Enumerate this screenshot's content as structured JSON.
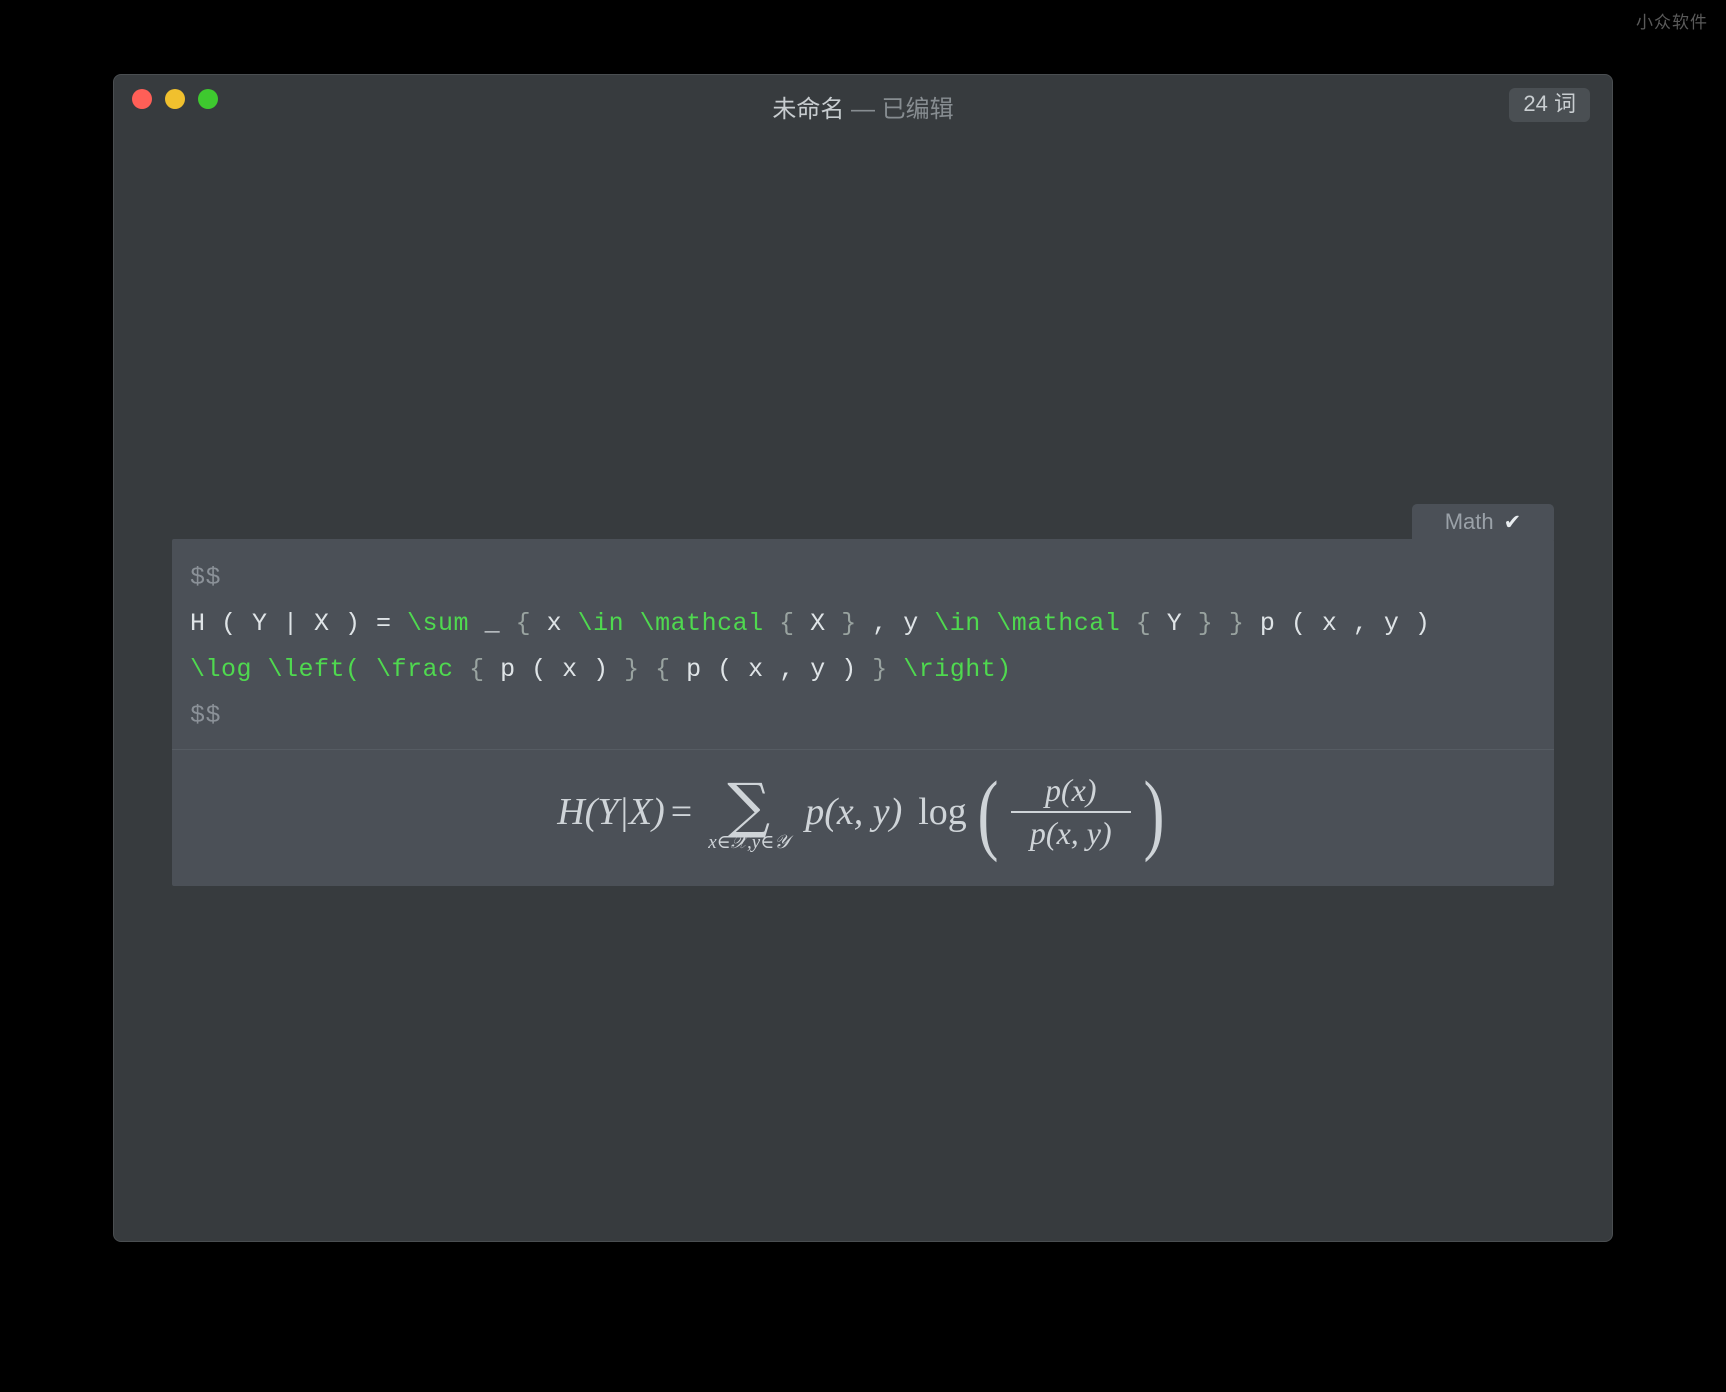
{
  "watermark": "小众软件",
  "window": {
    "titlebar": {
      "title_name": "未命名",
      "title_separator": " — ",
      "title_state": "已编辑",
      "word_count": "24 词",
      "traffic_lights": [
        {
          "name": "close",
          "color": "#ff5f57"
        },
        {
          "name": "minimize",
          "color": "#f0c02e"
        },
        {
          "name": "maximize",
          "color": "#3ec92f"
        }
      ]
    },
    "math_block": {
      "tab_label": "Math",
      "tab_check": "✔",
      "code_lines": [
        {
          "id": "open-delim",
          "tokens": [
            {
              "t": "$$",
              "k": "delim"
            }
          ]
        },
        {
          "id": "latex-line-1",
          "tokens": [
            {
              "t": "H ( Y | X ) = ",
              "k": "plain"
            },
            {
              "t": "\\sum",
              "k": "cmd"
            },
            {
              "t": " _ ",
              "k": "plain"
            },
            {
              "t": "{",
              "k": "brace"
            },
            {
              "t": " x ",
              "k": "plain"
            },
            {
              "t": "\\in \\mathcal",
              "k": "cmd"
            },
            {
              "t": " ",
              "k": "plain"
            },
            {
              "t": "{",
              "k": "brace"
            },
            {
              "t": " X ",
              "k": "plain"
            },
            {
              "t": "}",
              "k": "brace"
            },
            {
              "t": " , y ",
              "k": "plain"
            },
            {
              "t": "\\in \\mathcal",
              "k": "cmd"
            },
            {
              "t": " ",
              "k": "plain"
            },
            {
              "t": "{",
              "k": "brace"
            },
            {
              "t": " Y ",
              "k": "plain"
            },
            {
              "t": "}",
              "k": "brace"
            },
            {
              "t": " ",
              "k": "plain"
            },
            {
              "t": "}",
              "k": "brace"
            },
            {
              "t": " p ( x , y )",
              "k": "plain"
            }
          ]
        },
        {
          "id": "latex-line-2",
          "tokens": [
            {
              "t": "\\log \\left(",
              "k": "cmd"
            },
            {
              "t": " ",
              "k": "plain"
            },
            {
              "t": "\\frac",
              "k": "cmd"
            },
            {
              "t": " ",
              "k": "plain"
            },
            {
              "t": "{",
              "k": "brace"
            },
            {
              "t": " p ( x ) ",
              "k": "plain"
            },
            {
              "t": "}",
              "k": "brace"
            },
            {
              "t": " ",
              "k": "plain"
            },
            {
              "t": "{",
              "k": "brace"
            },
            {
              "t": " p ( x , y ) ",
              "k": "plain"
            },
            {
              "t": "}",
              "k": "brace"
            },
            {
              "t": " ",
              "k": "plain"
            },
            {
              "t": "\\right)",
              "k": "cmd"
            }
          ]
        },
        {
          "id": "close-delim",
          "tokens": [
            {
              "t": "$$",
              "k": "delim"
            }
          ]
        }
      ],
      "latex_source": "$$\nH ( Y | X ) = \\sum _ { x \\in \\mathcal { X } , y \\in \\mathcal { Y } } p ( x , y ) \\log \\left( \\frac { p ( x ) } { p ( x , y ) } \\right)\n$$",
      "rendered": {
        "lhs": "H(Y|X)",
        "equals": "=",
        "sum_symbol": "∑",
        "sum_subscript": "x∈𝒳,y∈𝒴",
        "probability": "p(x, y)",
        "log_label": "log",
        "paren_open": "(",
        "paren_close": ")",
        "fraction_numerator": "p(x)",
        "fraction_denominator": "p(x, y)"
      }
    }
  },
  "colors": {
    "page_background": "#000000",
    "window_background": "#373b3e",
    "panel_background": "#4b5057",
    "accent_latex_command": "#4fd94f",
    "text_primary": "#dfe4e7",
    "text_muted": "#8b9198"
  }
}
